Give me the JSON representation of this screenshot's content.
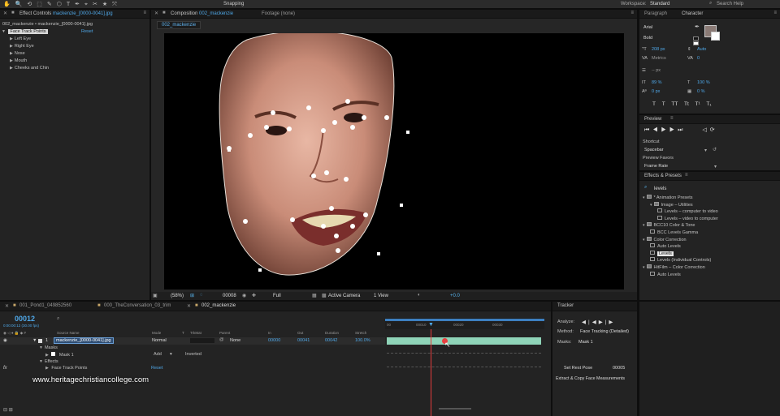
{
  "topbar": {
    "snapping": "Snapping",
    "workspace_label": "Workspace:",
    "workspace_value": "Standard",
    "search_help": "Search Help"
  },
  "effect_controls": {
    "tab_prefix": "Effect Controls",
    "tab_file": "mackenzie_[0000-0041].jpg",
    "subtitle": "002_mackenzie • mackenzie_[0000-0041].jpg",
    "effect_name": "Face Track Points",
    "reset": "Reset",
    "items": [
      "Left Eye",
      "Right Eye",
      "Nose",
      "Mouth",
      "Cheeks and Chin"
    ]
  },
  "composition": {
    "tab_prefix": "Composition",
    "tab_name": "002_mackenzie",
    "footage_tab": "Footage (none)",
    "comp_chip": "002_mackenzie",
    "zoom": "(58%)",
    "timecode": "00008",
    "resolution": "Full",
    "camera": "Active Camera",
    "view": "1 View",
    "exposure": "+0.0"
  },
  "character": {
    "tab_paragraph": "Paragraph",
    "tab_character": "Character",
    "font": "Arial",
    "style": "Bold",
    "size": "208 px",
    "leading": "Auto",
    "kerning": "Metrics",
    "tracking": "0",
    "stroke": "-- px",
    "vscale": "89 %",
    "hscale": "100 %",
    "baseline": "0 px",
    "tsume": "0 %",
    "styles": [
      "T",
      "T",
      "TT",
      "Tt",
      "T¹",
      "T₁"
    ]
  },
  "preview": {
    "title": "Preview",
    "shortcut_label": "Shortcut",
    "shortcut_value": "Spacebar",
    "favors_label": "Preview Favors",
    "favors_value": "Frame Rate"
  },
  "effects_presets": {
    "title": "Effects & Presets",
    "search": "levels",
    "tree": [
      {
        "label": "* Animation Presets",
        "indent": 0,
        "arrow": "▾"
      },
      {
        "label": "Image – Utilities",
        "indent": 1,
        "arrow": "▾"
      },
      {
        "label": "Levels – computer to video",
        "indent": 2,
        "arrow": ""
      },
      {
        "label": "Levels – video to computer",
        "indent": 2,
        "arrow": ""
      },
      {
        "label": "BCC10 Color & Tone",
        "indent": 0,
        "arrow": "▾"
      },
      {
        "label": "BCC Levels Gamma",
        "indent": 1,
        "arrow": ""
      },
      {
        "label": "Color Correction",
        "indent": 0,
        "arrow": "▾"
      },
      {
        "label": "Auto Levels",
        "indent": 1,
        "arrow": ""
      },
      {
        "label": "Levels",
        "indent": 1,
        "arrow": "",
        "selected": true
      },
      {
        "label": "Levels (Individual Controls)",
        "indent": 1,
        "arrow": ""
      },
      {
        "label": "HitFilm – Color Correction",
        "indent": 0,
        "arrow": "▾"
      },
      {
        "label": "Auto Levels",
        "indent": 1,
        "arrow": ""
      }
    ]
  },
  "timeline": {
    "tabs": [
      "001_Pond1_049852560",
      "000_TheConversation_03_trim",
      "002_mackenzie"
    ],
    "timecode": "00012",
    "timecode_sub": "0:00:00:12 (30.00 fps)",
    "columns": [
      "Source Name",
      "Mode",
      "T",
      "TrkMat",
      "Parent",
      "In",
      "Out",
      "Duration",
      "Stretch"
    ],
    "layer": {
      "num": "1",
      "name": "mackenzie_[0000-0041].jpg",
      "mode": "Normal",
      "parent": "None",
      "in": "00000",
      "out": "00041",
      "duration": "00042",
      "stretch": "100.0%"
    },
    "masks_label": "Masks",
    "mask_name": "Mask 1",
    "mask_mode": "Add",
    "mask_inverted": "Inverted",
    "effects_label": "Effects",
    "effect_name": "Face Track Points",
    "effect_reset": "Reset",
    "ruler": [
      "00",
      "00010",
      "00020",
      "00030"
    ]
  },
  "tracker": {
    "title": "Tracker",
    "analyze": "Analyze:",
    "method_label": "Method:",
    "method_value": "Face Tracking (Detailed)",
    "masks_label": "Masks:",
    "masks_value": "Mask 1",
    "set_rest": "Set Rest Pose",
    "rest_value": "00005",
    "extract": "Extract & Copy Face Measurements"
  },
  "watermark": "www.heritagechristiancollege.com"
}
